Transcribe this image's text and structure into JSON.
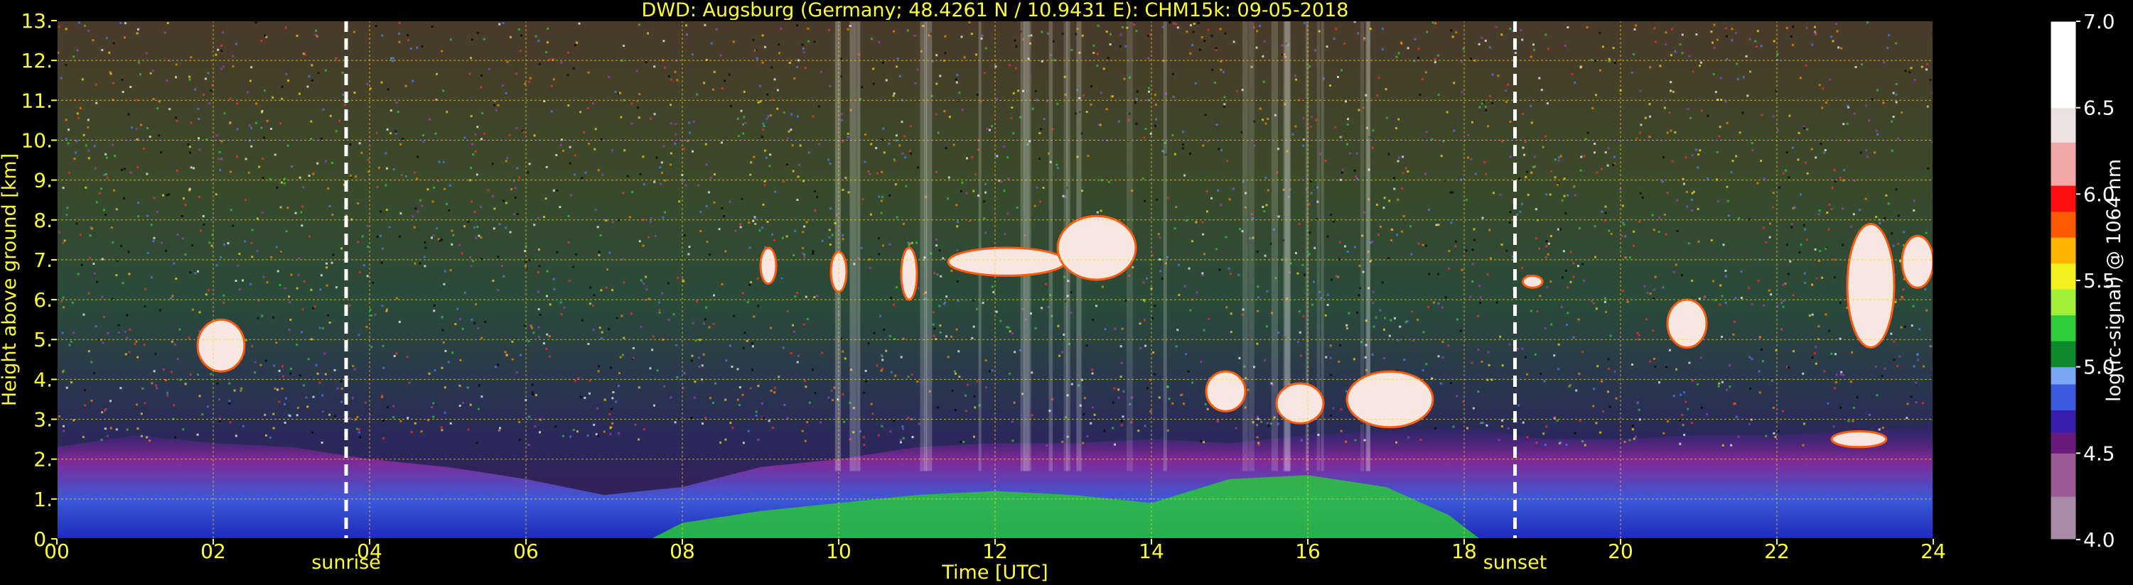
{
  "chart_data": {
    "type": "heatmap",
    "title": "DWD: Augsburg (Germany; 48.4261 N / 10.9431 E):    CHM15k: 09-05-2018",
    "xlabel": "Time [UTC]",
    "ylabel": "Height above ground [km]",
    "xlim": [
      0,
      24
    ],
    "ylim": [
      0,
      13
    ],
    "x_ticks": [
      0,
      2,
      4,
      6,
      8,
      10,
      12,
      14,
      16,
      18,
      20,
      22,
      24
    ],
    "x_tick_labels": [
      "00",
      "02",
      "04",
      "06",
      "08",
      "10",
      "12",
      "14",
      "16",
      "18",
      "20",
      "22",
      "24"
    ],
    "y_ticks": [
      0,
      1,
      2,
      3,
      4,
      5,
      6,
      7,
      8,
      9,
      10,
      11,
      12,
      13
    ],
    "y_tick_labels": [
      "0.",
      "1.",
      "2.",
      "3.",
      "4.",
      "5.",
      "6.",
      "7.",
      "8.",
      "9.",
      "10.",
      "11.",
      "12.",
      "13."
    ],
    "grid": true,
    "markers": [
      {
        "label": "sunrise",
        "x": 3.7
      },
      {
        "label": "sunset",
        "x": 18.65
      }
    ],
    "cloud_patches": [
      {
        "x": [
          1.8,
          2.4
        ],
        "y": [
          4.2,
          5.5
        ]
      },
      {
        "x": [
          9.0,
          9.2
        ],
        "y": [
          6.4,
          7.3
        ]
      },
      {
        "x": [
          9.9,
          10.1
        ],
        "y": [
          6.2,
          7.2
        ]
      },
      {
        "x": [
          10.8,
          11.0
        ],
        "y": [
          6.0,
          7.3
        ]
      },
      {
        "x": [
          11.4,
          12.9
        ],
        "y": [
          6.6,
          7.3
        ]
      },
      {
        "x": [
          12.8,
          13.8
        ],
        "y": [
          6.5,
          8.1
        ]
      },
      {
        "x": [
          14.7,
          15.2
        ],
        "y": [
          3.2,
          4.2
        ]
      },
      {
        "x": [
          15.6,
          16.2
        ],
        "y": [
          2.9,
          3.9
        ]
      },
      {
        "x": [
          16.5,
          17.6
        ],
        "y": [
          2.8,
          4.2
        ]
      },
      {
        "x": [
          18.75,
          19.0
        ],
        "y": [
          6.3,
          6.6
        ]
      },
      {
        "x": [
          20.6,
          21.1
        ],
        "y": [
          4.8,
          6.0
        ]
      },
      {
        "x": [
          22.9,
          23.5
        ],
        "y": [
          4.8,
          7.9
        ]
      },
      {
        "x": [
          23.6,
          24.0
        ],
        "y": [
          6.3,
          7.6
        ]
      },
      {
        "x": [
          22.7,
          23.4
        ],
        "y": [
          2.3,
          2.7
        ]
      }
    ],
    "boundary_layer_top_km": [
      [
        0,
        2.3
      ],
      [
        1,
        2.6
      ],
      [
        2,
        2.4
      ],
      [
        3,
        2.3
      ],
      [
        4,
        2.0
      ],
      [
        5,
        1.8
      ],
      [
        6,
        1.5
      ],
      [
        7,
        1.1
      ],
      [
        8,
        1.3
      ],
      [
        9,
        1.8
      ],
      [
        10,
        2.0
      ],
      [
        11,
        2.3
      ],
      [
        12,
        2.4
      ],
      [
        13,
        2.4
      ],
      [
        14,
        2.5
      ],
      [
        15,
        2.4
      ],
      [
        16,
        2.6
      ],
      [
        17,
        2.7
      ],
      [
        18,
        2.8
      ],
      [
        19,
        2.5
      ],
      [
        20,
        2.5
      ],
      [
        21,
        2.6
      ],
      [
        22,
        2.6
      ],
      [
        23,
        2.7
      ],
      [
        24,
        2.8
      ]
    ],
    "colorbar": {
      "label": "log(rc-signal) @ 1064 nm",
      "range": [
        4.0,
        7.0
      ],
      "tick_values": [
        4.0,
        4.5,
        5.0,
        5.5,
        6.0,
        6.5,
        7.0
      ],
      "tick_labels": [
        "4.0",
        "4.5",
        "5.0",
        "5.5",
        "6.0",
        "6.5",
        "7.0"
      ],
      "stops": [
        {
          "v": 4.0,
          "color": "#a88aa6"
        },
        {
          "v": 4.25,
          "color": "#9c5a96"
        },
        {
          "v": 4.5,
          "color": "#6a1a7a"
        },
        {
          "v": 4.62,
          "color": "#3a1eb0"
        },
        {
          "v": 4.75,
          "color": "#3a5be0"
        },
        {
          "v": 4.9,
          "color": "#7aa6f4"
        },
        {
          "v": 5.0,
          "color": "#0c8a2c"
        },
        {
          "v": 5.15,
          "color": "#2ccf3a"
        },
        {
          "v": 5.3,
          "color": "#a0f03a"
        },
        {
          "v": 5.45,
          "color": "#f4f020"
        },
        {
          "v": 5.6,
          "color": "#ffb400"
        },
        {
          "v": 5.75,
          "color": "#ff5a00"
        },
        {
          "v": 5.9,
          "color": "#ff1010"
        },
        {
          "v": 6.05,
          "color": "#f2a8a8"
        },
        {
          "v": 6.3,
          "color": "#ece0e0"
        },
        {
          "v": 6.5,
          "color": "#ffffff"
        },
        {
          "v": 7.0,
          "color": "#ffffff"
        }
      ]
    }
  },
  "colors": {
    "text": "#ffff33",
    "background": "#000000",
    "grid": "#ffd21a",
    "marker_line": "#ffffff"
  }
}
